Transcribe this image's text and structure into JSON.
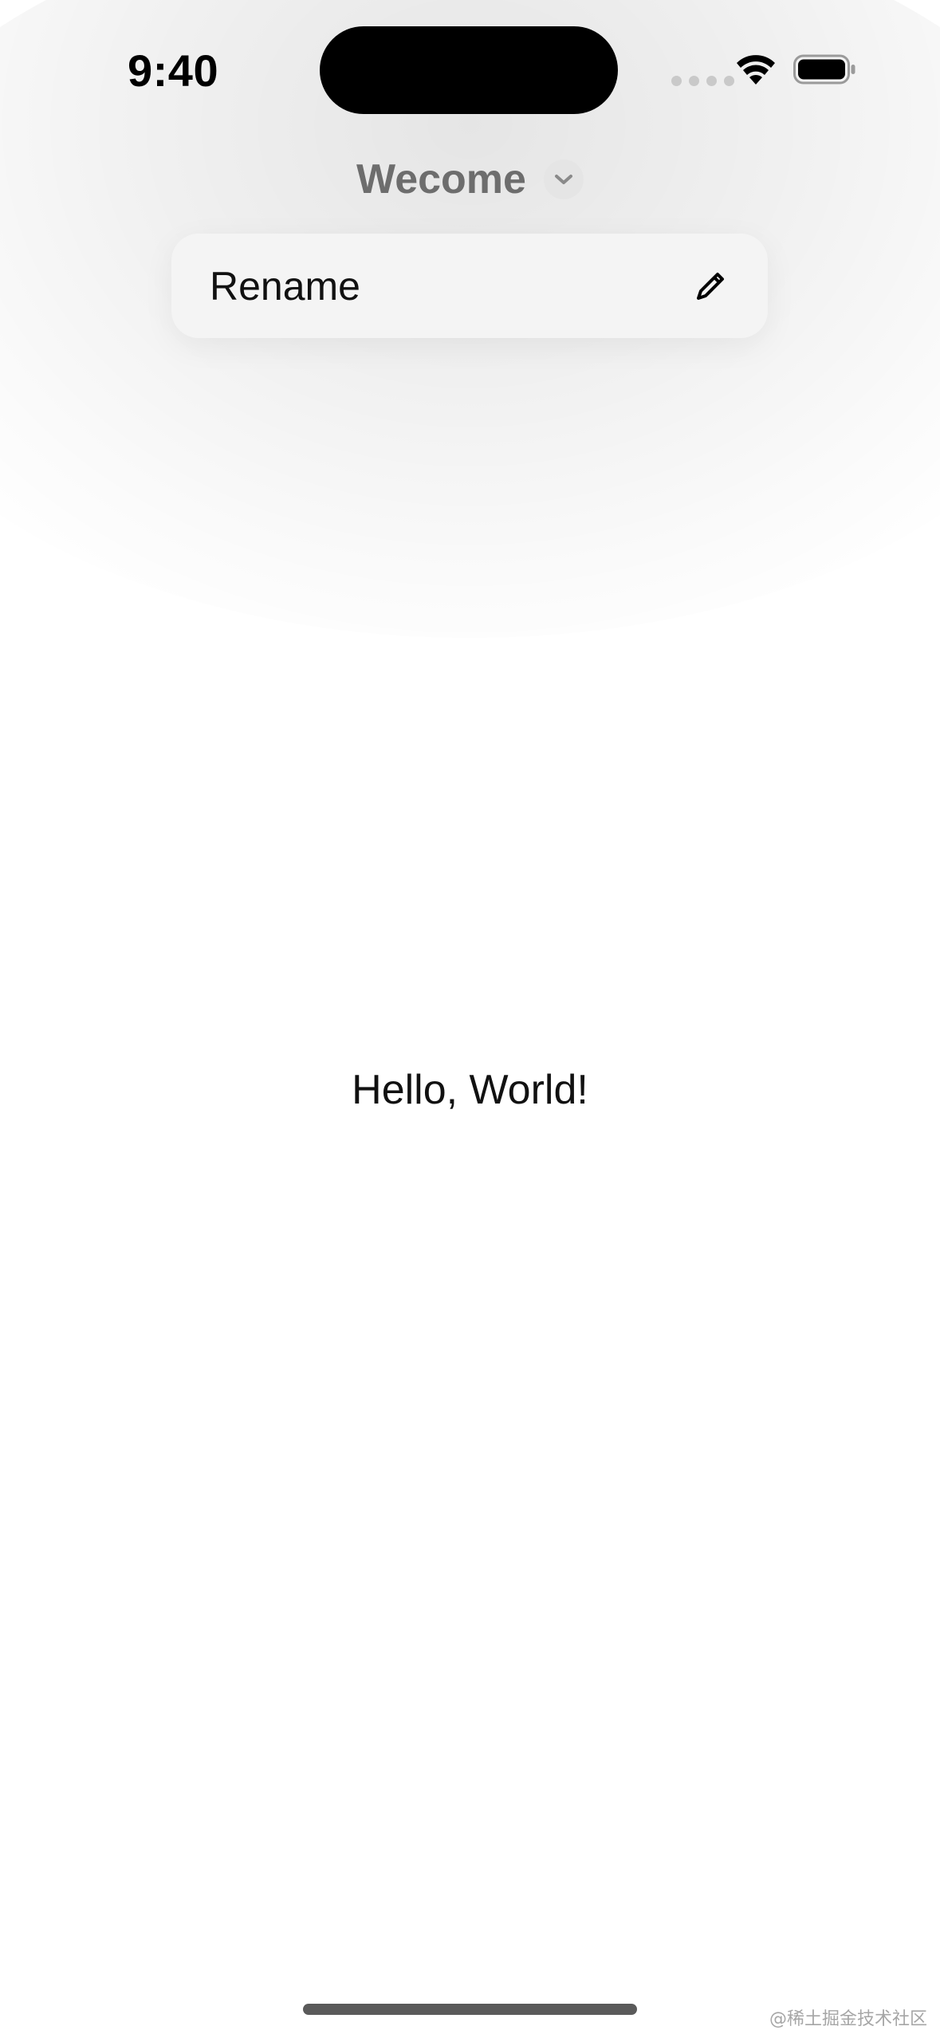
{
  "status_bar": {
    "time": "9:40"
  },
  "nav": {
    "title": "Wecome"
  },
  "menu": {
    "items": [
      {
        "label": "Rename",
        "icon": "pencil-icon"
      }
    ]
  },
  "content": {
    "text": "Hello, World!"
  },
  "watermark": {
    "text": "@稀土掘金技术社区"
  },
  "colors": {
    "background": "#ffffff",
    "menu_bg": "#f4f4f4",
    "title_gray": "#6d6d6d",
    "badge_bg": "#e5e5e5"
  }
}
